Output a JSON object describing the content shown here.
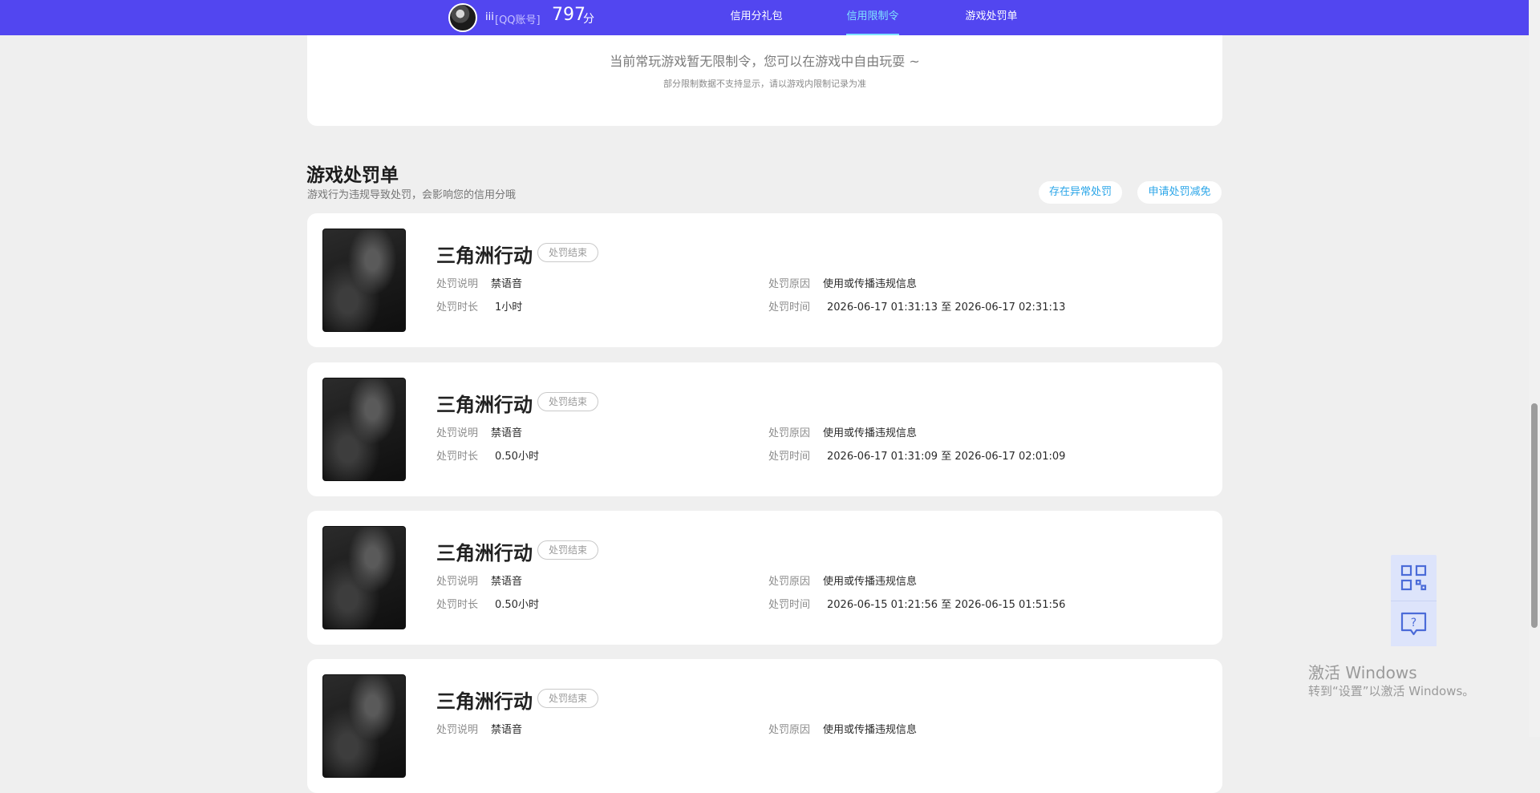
{
  "header": {
    "username": "iii",
    "account_type": "[QQ账号]",
    "score": "797",
    "score_unit": "分",
    "nav": [
      {
        "label": "信用分礼包"
      },
      {
        "label": "信用限制令"
      },
      {
        "label": "游戏处罚单"
      }
    ],
    "active_tab": "信用限制令"
  },
  "restriction": {
    "message": "当前常玩游戏暂无限制令，您可以在游戏中自由玩耍 ~",
    "note": "部分限制数据不支持显示，请以游戏内限制记录为准"
  },
  "penalties": {
    "title": "游戏处罚单",
    "subtitle": "游戏行为违规导致处罚，会影响您的信用分哦",
    "report_button": "存在异常处罚",
    "appeal_button": "申请处罚减免",
    "labels": {
      "desc": "处罚说明",
      "duration": "处罚时长",
      "reason": "处罚原因",
      "time": "处罚时间"
    },
    "records": [
      {
        "game": "三角洲行动",
        "status": "处罚结束",
        "desc": "禁语音",
        "duration": "1小时",
        "reason": "使用或传播违规信息",
        "time": "2026-06-17 01:31:13 至 2026-06-17 02:31:13"
      },
      {
        "game": "三角洲行动",
        "status": "处罚结束",
        "desc": "禁语音",
        "duration": "0.50小时",
        "reason": "使用或传播违规信息",
        "time": "2026-06-17 01:31:09 至 2026-06-17 02:01:09"
      },
      {
        "game": "三角洲行动",
        "status": "处罚结束",
        "desc": "禁语音",
        "duration": "0.50小时",
        "reason": "使用或传播违规信息",
        "time": "2026-06-15 01:21:56 至 2026-06-15 01:51:56"
      },
      {
        "game": "三角洲行动",
        "status": "处罚结束",
        "desc": "禁语音",
        "duration": "",
        "reason": "使用或传播违规信息",
        "time": ""
      }
    ]
  },
  "side_widget": {
    "icons": [
      "qrcode-icon",
      "help-chat-icon"
    ]
  },
  "watermark": {
    "line1": "激活 Windows",
    "line2": "转到“设置”以激活 Windows。"
  },
  "colors": {
    "topbar": "#5246f0",
    "active_nav": "#7fe3ff",
    "accent_link": "#2aa5e8",
    "page_bg": "#efefef"
  }
}
